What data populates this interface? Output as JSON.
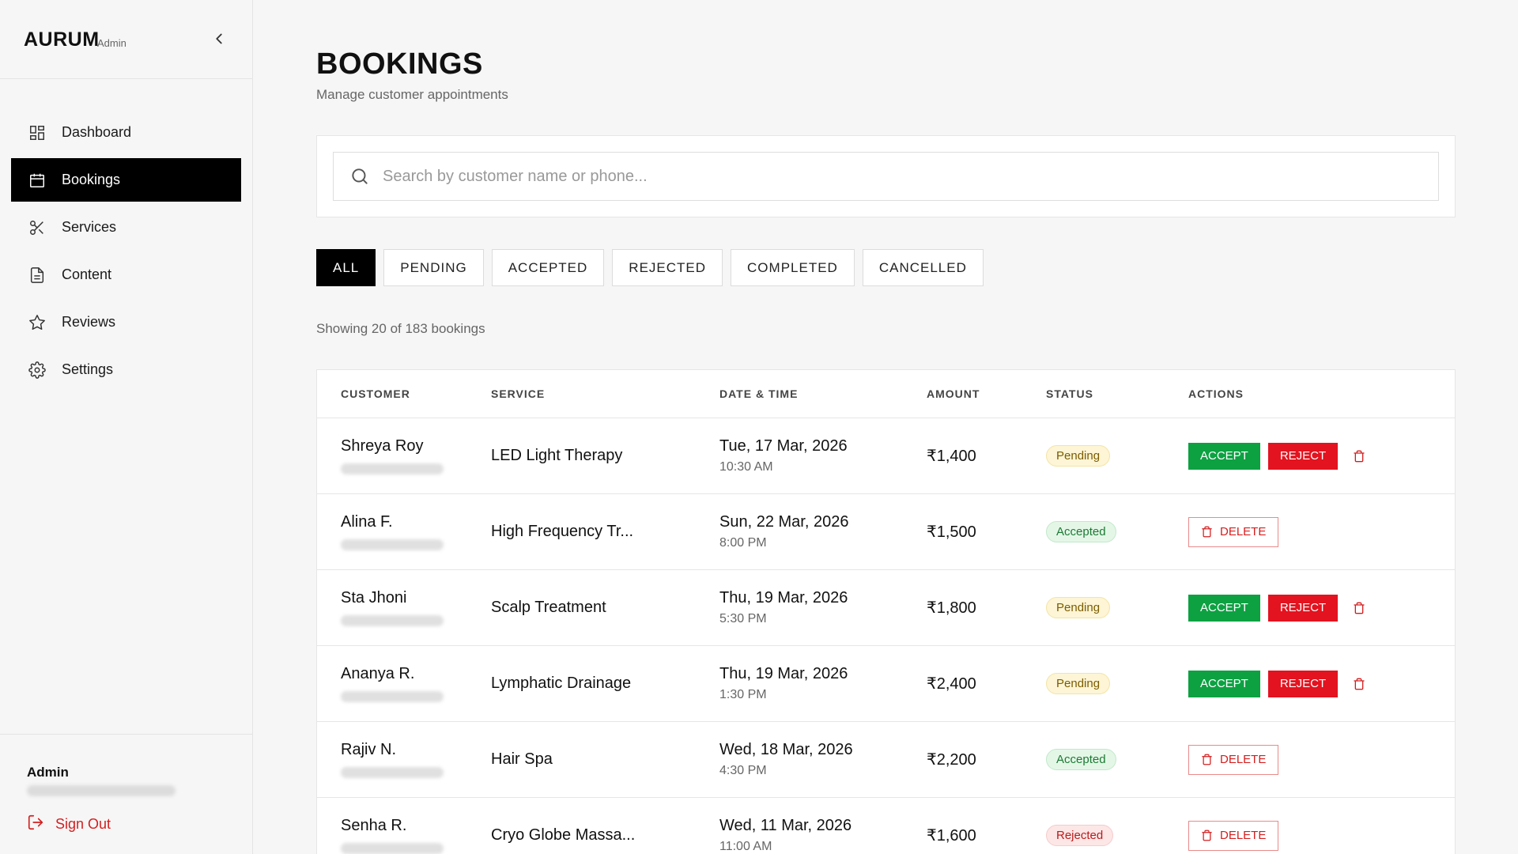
{
  "brand": {
    "name": "AURUM",
    "sub": "Admin"
  },
  "nav": {
    "items": [
      {
        "label": "Dashboard",
        "icon": "grid-icon"
      },
      {
        "label": "Bookings",
        "icon": "calendar-icon",
        "active": true
      },
      {
        "label": "Services",
        "icon": "scissors-icon"
      },
      {
        "label": "Content",
        "icon": "document-icon"
      },
      {
        "label": "Reviews",
        "icon": "star-icon"
      },
      {
        "label": "Settings",
        "icon": "gear-icon"
      }
    ]
  },
  "footer": {
    "admin_name": "Admin",
    "sign_out": "Sign Out"
  },
  "page": {
    "title": "BOOKINGS",
    "subtitle": "Manage customer appointments"
  },
  "search": {
    "placeholder": "Search by customer name or phone..."
  },
  "filters": [
    "ALL",
    "PENDING",
    "ACCEPTED",
    "REJECTED",
    "COMPLETED",
    "CANCELLED"
  ],
  "showing": "Showing 20 of 183 bookings",
  "table": {
    "headers": [
      "CUSTOMER",
      "SERVICE",
      "DATE & TIME",
      "AMOUNT",
      "STATUS",
      "ACTIONS"
    ],
    "action_labels": {
      "accept": "ACCEPT",
      "reject": "REJECT",
      "delete": "DELETE"
    },
    "rows": [
      {
        "customer": "Shreya Roy",
        "service": "LED Light Therapy",
        "date": "Tue, 17 Mar, 2026",
        "time": "10:30 AM",
        "amount": "₹1,400",
        "status": "Pending"
      },
      {
        "customer": "Alina F.",
        "service": "High Frequency Tr...",
        "date": "Sun, 22 Mar, 2026",
        "time": "8:00 PM",
        "amount": "₹1,500",
        "status": "Accepted"
      },
      {
        "customer": "Sta Jhoni",
        "service": "Scalp Treatment",
        "date": "Thu, 19 Mar, 2026",
        "time": "5:30 PM",
        "amount": "₹1,800",
        "status": "Pending"
      },
      {
        "customer": "Ananya R.",
        "service": "Lymphatic Drainage",
        "date": "Thu, 19 Mar, 2026",
        "time": "1:30 PM",
        "amount": "₹2,400",
        "status": "Pending"
      },
      {
        "customer": "Rajiv N.",
        "service": "Hair Spa",
        "date": "Wed, 18 Mar, 2026",
        "time": "4:30 PM",
        "amount": "₹2,200",
        "status": "Accepted"
      },
      {
        "customer": "Senha R.",
        "service": "Cryo Globe Massa...",
        "date": "Wed, 11 Mar, 2026",
        "time": "11:00 AM",
        "amount": "₹1,600",
        "status": "Rejected"
      }
    ]
  },
  "colors": {
    "accept": "#0da142",
    "reject": "#e3131f",
    "active_nav": "#000000",
    "sign_out": "#d41f1f"
  }
}
